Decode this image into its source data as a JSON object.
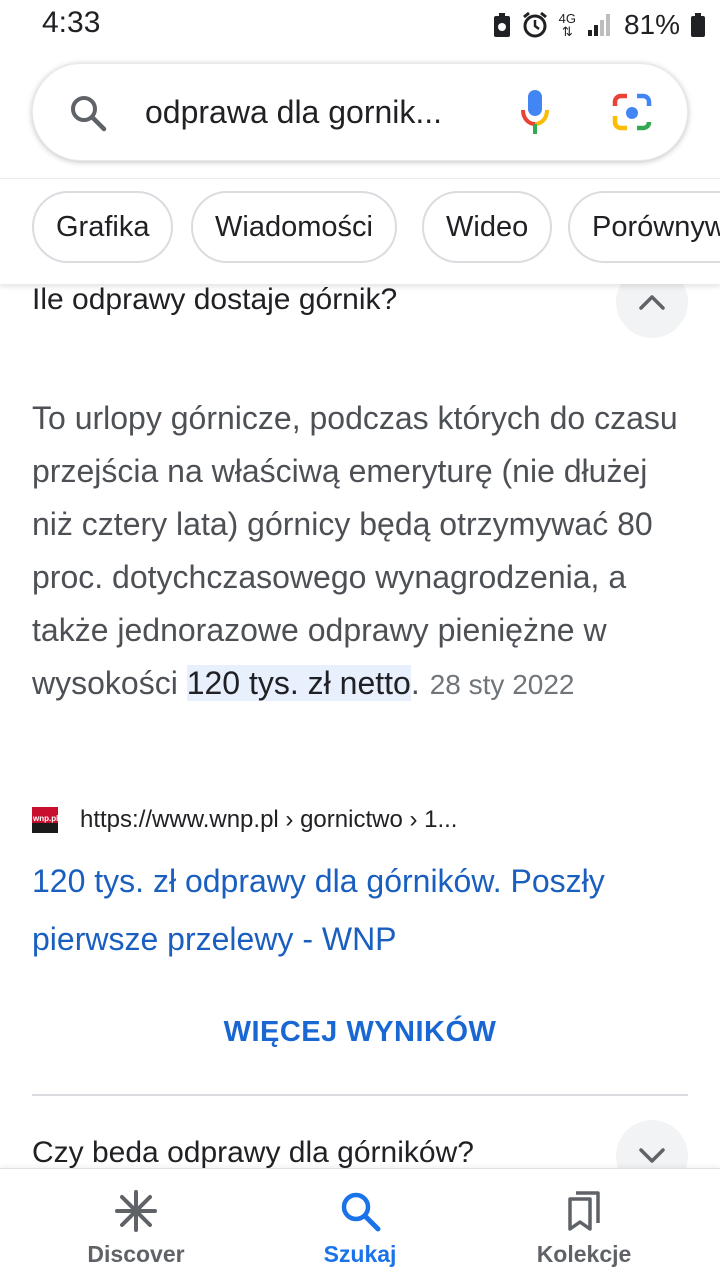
{
  "status_bar": {
    "time": "4:33",
    "network": "4G",
    "battery": "81%"
  },
  "search": {
    "query": "odprawa dla gornik..."
  },
  "chips": [
    {
      "label": "Grafika"
    },
    {
      "label": "Wiadomości"
    },
    {
      "label": "Wideo"
    },
    {
      "label": "Porównywa"
    }
  ],
  "question_1": {
    "title": "Ile odprawy dostaje górnik?",
    "expanded": true,
    "answer_text": "To urlopy górnicze, podczas których do czasu przejścia na właściwą emeryturę (nie dłużej niż cztery lata) górnicy będą otrzymywać 80 proc. dotychczasowego wynagrodzenia, a także jednorazowe odprawy pieniężne w wysokości ",
    "answer_highlight": "120 tys. zł netto",
    "answer_end": ".",
    "date": "28 sty 2022",
    "source_favicon": "wnp.pl",
    "source_url": "https://www.wnp.pl › gornictwo › 1...",
    "result_title": "120 tys. zł odprawy dla górników. Poszły pierwsze przelewy - WNP"
  },
  "more_results": "WIĘCEJ WYNIKÓW",
  "question_2": {
    "title": "Czy beda odprawy dla górników?",
    "expanded": false
  },
  "bottom_nav": [
    {
      "label": "Discover",
      "icon": "asterisk-icon",
      "active": false
    },
    {
      "label": "Szukaj",
      "icon": "search-icon",
      "active": true
    },
    {
      "label": "Kolekcje",
      "icon": "bookmarks-icon",
      "active": false
    }
  ],
  "colors": {
    "accent": "#1a73e8",
    "link": "#1a5fbf",
    "highlight_bg": "#e8f0fe"
  }
}
